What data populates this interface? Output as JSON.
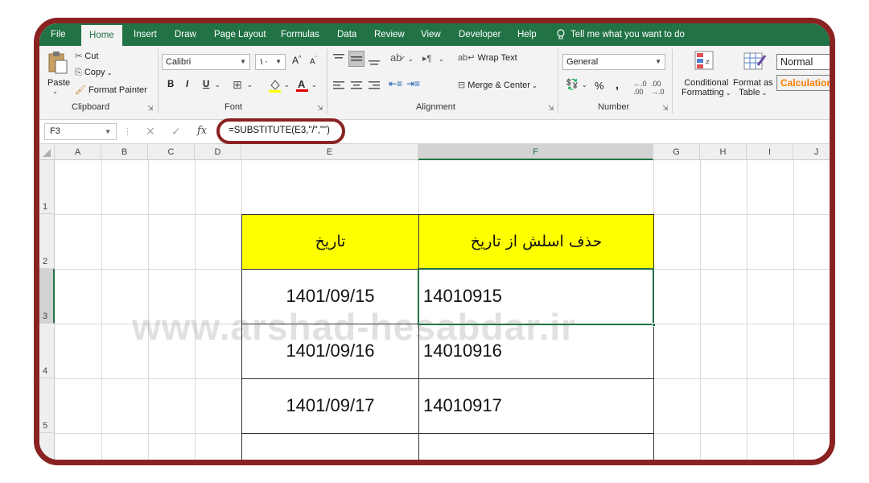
{
  "menu": {
    "tabs": [
      "File",
      "Home",
      "Insert",
      "Draw",
      "Page Layout",
      "Formulas",
      "Data",
      "Review",
      "View",
      "Developer",
      "Help"
    ],
    "active_tab": "Home",
    "tell_me": "Tell me what you want to do"
  },
  "ribbon": {
    "clipboard": {
      "paste": "Paste",
      "cut": "Cut",
      "copy": "Copy",
      "format_painter": "Format Painter",
      "group_label": "Clipboard"
    },
    "font": {
      "name": "Calibri",
      "size": "۱۰",
      "group_label": "Font",
      "bold": "B",
      "italic": "I",
      "underline": "U"
    },
    "alignment": {
      "wrap_text": "Wrap Text",
      "merge_center": "Merge & Center",
      "group_label": "Alignment"
    },
    "number": {
      "format": "General",
      "percent": "%",
      "comma": ",",
      "group_label": "Number"
    },
    "styles": {
      "conditional_line1": "Conditional",
      "conditional_line2": "Formatting",
      "format_as_line1": "Format as",
      "format_as_line2": "Table",
      "normal": "Normal",
      "calculation": "Calculation"
    }
  },
  "formula_bar": {
    "name_box": "F3",
    "fx": "fx",
    "formula": "=SUBSTITUTE(E3,\"/\",\"\")"
  },
  "columns": [
    "A",
    "B",
    "C",
    "D",
    "E",
    "F",
    "G",
    "H",
    "I",
    "J"
  ],
  "rows": [
    "1",
    "2",
    "3",
    "4",
    "5"
  ],
  "table": {
    "header_e": "تاریخ",
    "header_f": "حذف اسلش از تاریخ",
    "rows": [
      {
        "date": "1401/09/15",
        "result": "14010915"
      },
      {
        "date": "1401/09/16",
        "result": "14010916"
      },
      {
        "date": "1401/09/17",
        "result": "14010917"
      }
    ]
  },
  "watermark": "www.arshad-hesabdar.ir",
  "colors": {
    "excel_green": "#217346",
    "frame": "#8a2222",
    "header_fill": "#ffff00",
    "calculation": "#fa7d00"
  }
}
